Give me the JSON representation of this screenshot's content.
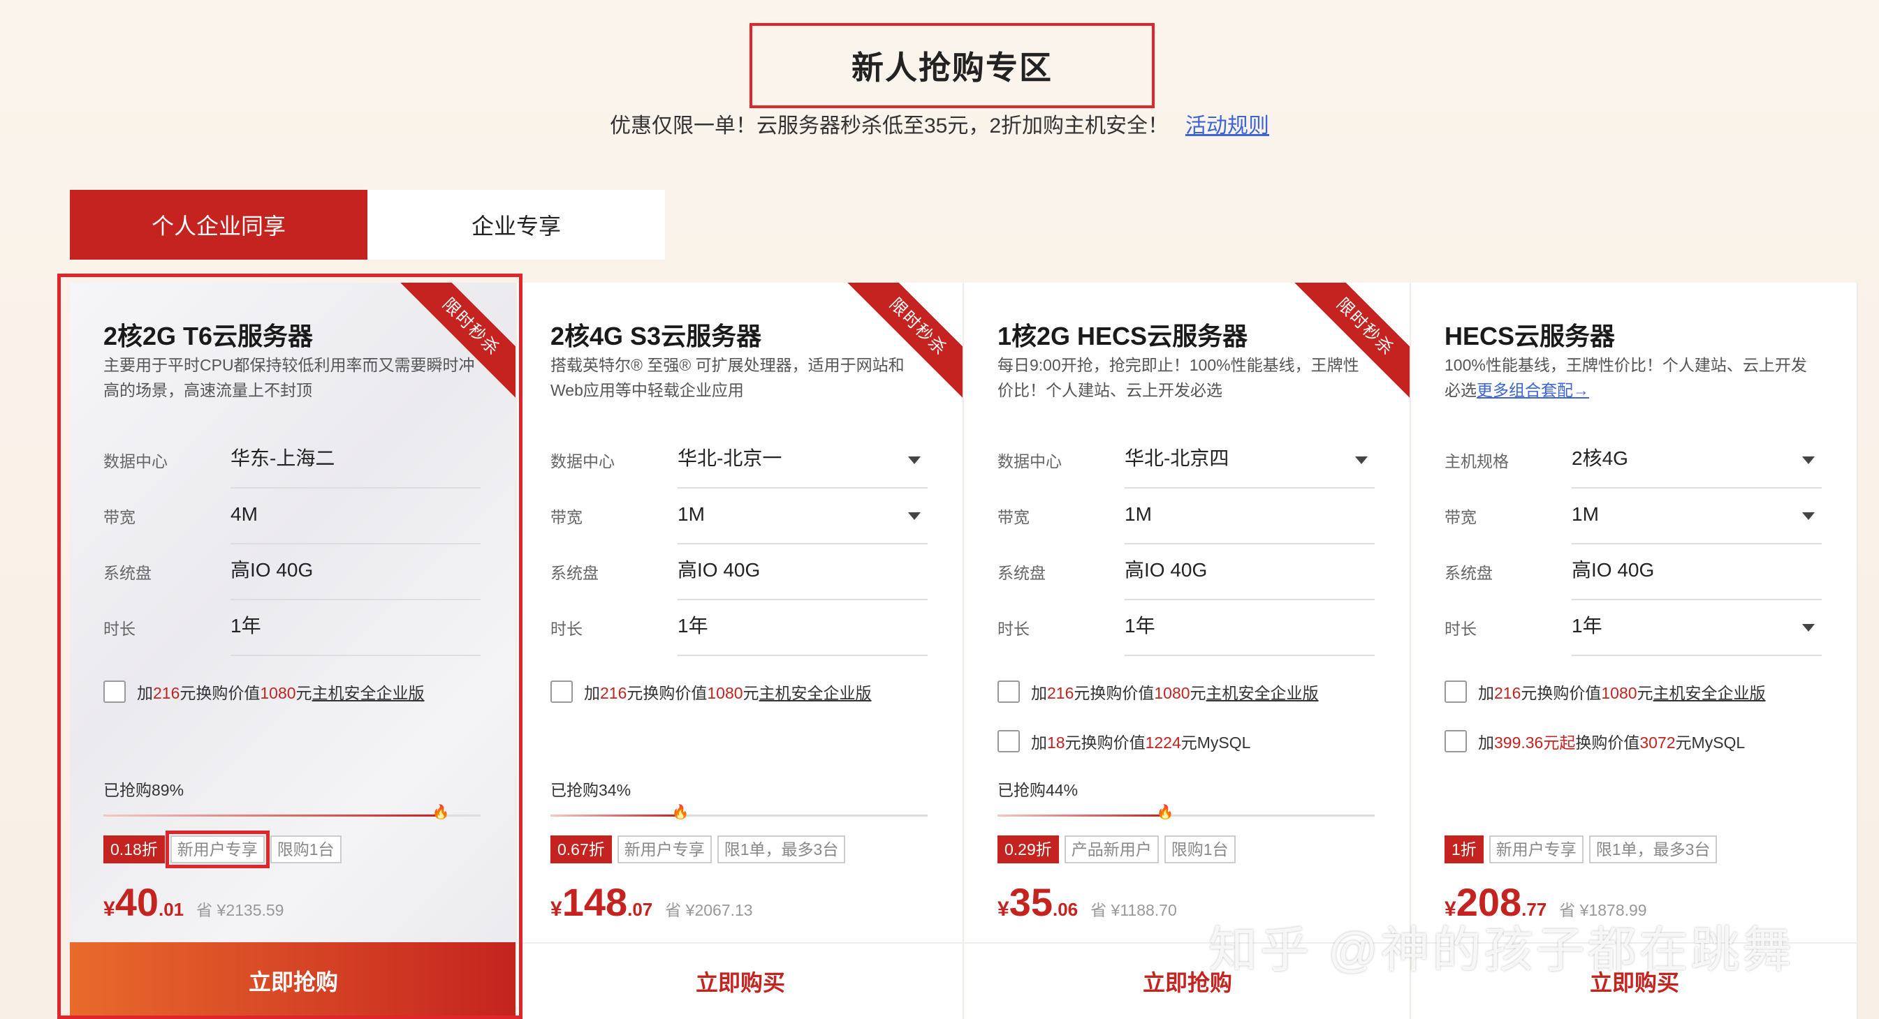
{
  "header": {
    "title": "新人抢购专区",
    "subtitle": "优惠仅限一单！云服务器秒杀低至35元，2折加购主机安全！",
    "rules_link": "活动规则"
  },
  "tabs": [
    {
      "label": "个人企业同享",
      "active": true
    },
    {
      "label": "企业专享",
      "active": false
    }
  ],
  "cards": [
    {
      "ribbon": "限时秒杀",
      "title": "2核2G T6云服务器",
      "desc": "主要用于平时CPU都保持较低利用率而又需要瞬时冲高的场景，高速流量上不封顶",
      "specs": [
        {
          "label": "数据中心",
          "value": "华东-上海二"
        },
        {
          "label": "带宽",
          "value": "4M"
        },
        {
          "label": "系统盘",
          "value": "高IO 40G"
        },
        {
          "label": "时长",
          "value": "1年"
        }
      ],
      "addon": {
        "p1": "加",
        "r1": "216",
        "p2": "元换购价值",
        "r2": "1080",
        "p3": "元",
        "link": "主机安全企业版"
      },
      "sold_text": "已抢购89%",
      "sold_percent": 89,
      "tags": [
        "0.18折",
        "新用户专享",
        "限购1台"
      ],
      "price": {
        "currency": "¥",
        "int": "40",
        "dec": ".01",
        "saved": "省 ¥2135.59"
      },
      "button": "立即抢购"
    },
    {
      "ribbon": "限时秒杀",
      "title": "2核4G S3云服务器",
      "desc": "搭载英特尔® 至强® 可扩展处理器，适用于网站和Web应用等中轻载企业应用",
      "specs": [
        {
          "label": "数据中心",
          "value": "华北-北京一"
        },
        {
          "label": "带宽",
          "value": "1M"
        },
        {
          "label": "系统盘",
          "value": "高IO 40G"
        },
        {
          "label": "时长",
          "value": "1年"
        }
      ],
      "addon": {
        "p1": "加",
        "r1": "216",
        "p2": "元换购价值",
        "r2": "1080",
        "p3": "元",
        "link": "主机安全企业版"
      },
      "sold_text": "已抢购34%",
      "sold_percent": 34,
      "tags": [
        "0.67折",
        "新用户专享",
        "限1单，最多3台"
      ],
      "price": {
        "currency": "¥",
        "int": "148",
        "dec": ".07",
        "saved": "省 ¥2067.13"
      },
      "button": "立即购买"
    },
    {
      "ribbon": "限时秒杀",
      "title": "1核2G HECS云服务器",
      "desc": "每日9:00开抢，抢完即止！100%性能基线，王牌性价比！个人建站、云上开发必选",
      "specs": [
        {
          "label": "数据中心",
          "value": "华北-北京四"
        },
        {
          "label": "带宽",
          "value": "1M"
        },
        {
          "label": "系统盘",
          "value": "高IO 40G"
        },
        {
          "label": "时长",
          "value": "1年"
        }
      ],
      "addon": {
        "p1": "加",
        "r1": "216",
        "p2": "元换购价值",
        "r2": "1080",
        "p3": "元",
        "link": "主机安全企业版"
      },
      "addon2": {
        "p1": "加",
        "r1": "18",
        "p2": "元换购价值",
        "r2": "1224",
        "p3": "元MySQL"
      },
      "sold_text": "已抢购44%",
      "sold_percent": 44,
      "tags": [
        "0.29折",
        "产品新用户",
        "限购1台"
      ],
      "price": {
        "currency": "¥",
        "int": "35",
        "dec": ".06",
        "saved": "省 ¥1188.70"
      },
      "button": "立即抢购"
    },
    {
      "title": "HECS云服务器",
      "desc": "100%性能基线，王牌性价比！个人建站、云上开发必选",
      "more_link": "更多组合套配→",
      "specs": [
        {
          "label": "主机规格",
          "value": "2核4G"
        },
        {
          "label": "带宽",
          "value": "1M"
        },
        {
          "label": "系统盘",
          "value": "高IO 40G"
        },
        {
          "label": "时长",
          "value": "1年"
        }
      ],
      "addon": {
        "p1": "加",
        "r1": "216",
        "p2": "元换购价值",
        "r2": "1080",
        "p3": "元",
        "link": "主机安全企业版"
      },
      "addon2": {
        "p1": "加",
        "r1": "399.36元起",
        "p2": "换购价值",
        "r2": "3072",
        "p3": "元MySQL"
      },
      "tags": [
        "1折",
        "新用户专享",
        "限1单，最多3台"
      ],
      "price": {
        "currency": "¥",
        "int": "208",
        "dec": ".77",
        "saved": "省 ¥1878.99"
      },
      "button": "立即购买"
    }
  ],
  "watermark": "知乎 @神的孩子都在跳舞",
  "colors": {
    "accent": "#c4231f",
    "highlight": "#e0262a",
    "link": "#3c64d6"
  }
}
